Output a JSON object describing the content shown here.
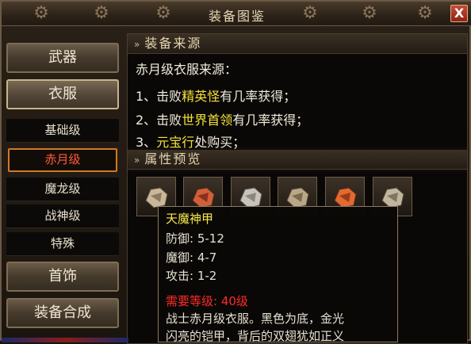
{
  "window": {
    "title": "装备图鉴",
    "close_label": "X"
  },
  "sidebar": {
    "categories": [
      {
        "label": "武器"
      },
      {
        "label": "衣服"
      },
      {
        "label": "首饰"
      },
      {
        "label": "装备合成"
      }
    ],
    "subitems": [
      {
        "label": "基础级"
      },
      {
        "label": "赤月级"
      },
      {
        "label": "魔龙级"
      },
      {
        "label": "战神级"
      },
      {
        "label": "特殊"
      }
    ]
  },
  "source": {
    "header": "装备来源",
    "intro": "赤月级衣服来源：",
    "lines": [
      {
        "prefix": "1、击败",
        "highlight": "精英怪",
        "suffix": "有几率获得；"
      },
      {
        "prefix": "2、击败",
        "highlight": "世界首领",
        "suffix": "有几率获得；"
      },
      {
        "prefix": "3、",
        "highlight": "元宝行",
        "suffix": "处购买；"
      }
    ]
  },
  "preview": {
    "header": "属性预览",
    "items": [
      {
        "icon": "armor-icon",
        "color": "#c9b79a"
      },
      {
        "icon": "armor-icon",
        "color": "#d0603a"
      },
      {
        "icon": "armor-icon",
        "color": "#c8c4bc"
      },
      {
        "icon": "armor-icon",
        "color": "#b8a888"
      },
      {
        "icon": "armor-icon",
        "color": "#e06a30"
      },
      {
        "icon": "armor-icon",
        "color": "#c0b6a0"
      }
    ]
  },
  "tooltip": {
    "name": "天魔神甲",
    "defense": "防御: 5-12",
    "magic_defense": "魔御: 4-7",
    "attack": "攻击: 1-2",
    "requirement": "需要等级: 40级",
    "desc1": "战士赤月级衣服。黑色为底，金光",
    "desc2": "闪亮的铠甲，背后的双翅犹如正义"
  }
}
